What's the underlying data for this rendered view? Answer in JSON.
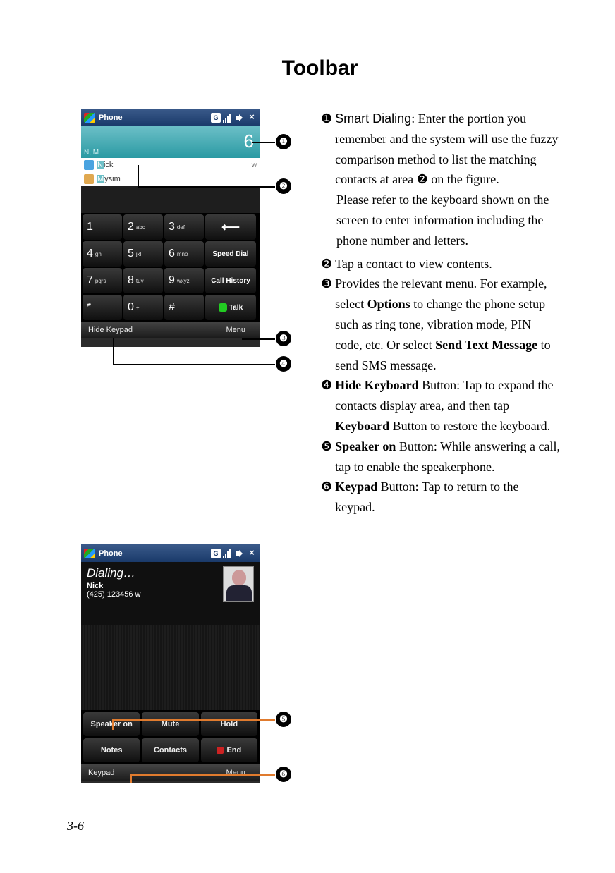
{
  "page": {
    "title": "Toolbar",
    "number": "3-6"
  },
  "phone1": {
    "title": "Phone",
    "dial_number": "6",
    "filter_hint": "N, M",
    "contacts": [
      {
        "icon_color": "#4aa3e0",
        "prefix": "N",
        "rest": "ick",
        "tag": "w"
      },
      {
        "icon_color": "#e0a850",
        "prefix": "M",
        "rest": "ysim",
        "tag": ""
      }
    ],
    "keypad": {
      "keys": [
        {
          "main": "1",
          "sub": ""
        },
        {
          "main": "2",
          "sub": "abc"
        },
        {
          "main": "3",
          "sub": "def"
        },
        {
          "side": "back"
        },
        {
          "main": "4",
          "sub": "ghi"
        },
        {
          "main": "5",
          "sub": "jkl"
        },
        {
          "main": "6",
          "sub": "mno"
        },
        {
          "side": "Speed Dial"
        },
        {
          "main": "7",
          "sub": "pqrs"
        },
        {
          "main": "8",
          "sub": "tuv"
        },
        {
          "main": "9",
          "sub": "wxyz"
        },
        {
          "side": "Call History"
        },
        {
          "main": "*",
          "sub": ""
        },
        {
          "main": "0",
          "sub": "+"
        },
        {
          "main": "#",
          "sub": ""
        },
        {
          "side": "Talk",
          "talk": true
        }
      ]
    },
    "soft_left": "Hide Keypad",
    "soft_right": "Menu"
  },
  "phone2": {
    "title": "Phone",
    "status": "Dialing…",
    "name": "Nick",
    "number": "(425) 123456 w",
    "buttons": [
      "Speaker on",
      "Mute",
      "Hold",
      "Notes",
      "Contacts",
      "End"
    ],
    "soft_left": "Keypad",
    "soft_right": "Menu"
  },
  "callouts": {
    "c1": "❶",
    "c2": "❷",
    "c3": "❸",
    "c4": "❹",
    "c5": "❺",
    "c6": "❻"
  },
  "desc": {
    "i1_lead": "Smart Dialing",
    "i1_a": ": Enter the portion you remember and the system will use the fuzzy comparison method to list the matching contacts at area ",
    "i1_ref": "❷",
    "i1_b": " on the figure.",
    "i1_c": "Please refer to the keyboard shown on the screen to enter information including the phone number and letters.",
    "i2": "Tap a contact to view contents.",
    "i3_a": "Provides the relevant menu. For example, select ",
    "i3_opt": "Options",
    "i3_b": " to change the phone setup such as ring tone, vibration mode, PIN code, etc. Or select ",
    "i3_sms": "Send Text Message",
    "i3_c": " to send SMS message.",
    "i4_bold": "Hide Keyboard",
    "i4_a": " Button: Tap to expand the contacts display area, and then tap ",
    "i4_kb": "Keyboard",
    "i4_b": " Button to restore the keyboard.",
    "i5_bold": "Speaker on",
    "i5": " Button: While answering a call, tap to enable the speakerphone.",
    "i6_bold": "Keypad",
    "i6": " Button: Tap to return to the keypad."
  }
}
